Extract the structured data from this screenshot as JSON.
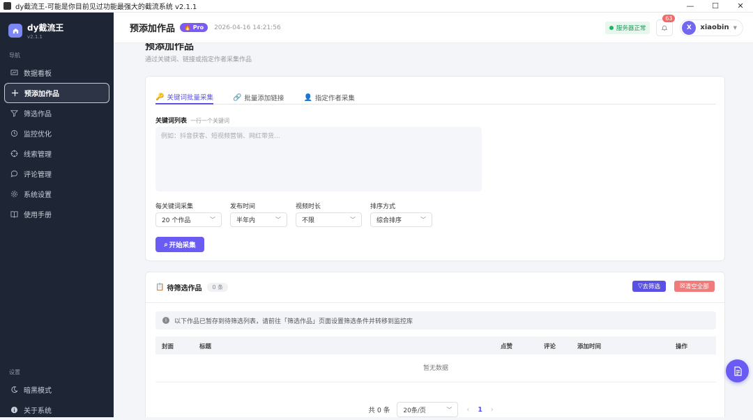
{
  "window": {
    "title": "dy截流王-可能是你目前见过功能最强大的截流系统 v2.1.1",
    "buttons": [
      "—",
      "☐",
      "✕"
    ]
  },
  "brand": {
    "name": "dy截流王",
    "version": "v2.1.1"
  },
  "sidebar": {
    "nav_label": "导航",
    "items": [
      {
        "label": "数据看板",
        "icon": "dashboard-icon"
      },
      {
        "label": "预添加作品",
        "icon": "plus-icon",
        "active": true
      },
      {
        "label": "筛选作品",
        "icon": "filter-icon"
      },
      {
        "label": "监控优化",
        "icon": "monitor-icon"
      },
      {
        "label": "线索管理",
        "icon": "target-icon"
      },
      {
        "label": "评论管理",
        "icon": "comment-icon"
      },
      {
        "label": "系统设置",
        "icon": "gear-icon"
      },
      {
        "label": "使用手册",
        "icon": "book-icon"
      }
    ],
    "settings_label": "设置",
    "bottom_items": [
      {
        "label": "暗黑模式",
        "icon": "moon-icon"
      },
      {
        "label": "关于系统",
        "icon": "info-icon"
      }
    ]
  },
  "topbar": {
    "title": "预添加作品",
    "pro_badge": "Pro",
    "timestamp": "2026-04-16 14:21:56",
    "server_status": "服务器正常",
    "notification_count": "63",
    "user_initial": "X",
    "username": "xiaobin"
  },
  "page": {
    "title": "预添加作品",
    "subtitle": "通过关键词、链接或指定作者采集作品"
  },
  "collect": {
    "tabs": [
      {
        "label": "关键词批量采集",
        "icon": "key-icon",
        "active": true
      },
      {
        "label": "批量添加链接",
        "icon": "link-icon"
      },
      {
        "label": "指定作者采集",
        "icon": "user-icon"
      }
    ],
    "keyword_label": "关键词列表",
    "keyword_hint": "一行一个关键词",
    "keyword_placeholder": "例如：抖音获客、短视频营销、网红带货...",
    "fields": [
      {
        "label": "每关键词采集",
        "value": "20 个作品"
      },
      {
        "label": "发布时间",
        "value": "半年内"
      },
      {
        "label": "视频时长",
        "value": "不限"
      },
      {
        "label": "排序方式",
        "value": "综合排序"
      }
    ],
    "start_button": "开始采集"
  },
  "pending": {
    "title": "待筛选作品",
    "count": "0 条",
    "filter_button": "去筛选",
    "clear_button": "清空全部",
    "notice": "以下作品已暂存到待筛选列表，请前往「筛选作品」页面设置筛选条件并转移到监控库",
    "columns": [
      "封面",
      "标题",
      "点赞",
      "评论",
      "添加时间",
      "操作"
    ],
    "empty_text": "暂无数据",
    "pagination": {
      "total": "共 0 条",
      "page_size": "20条/页",
      "current_page": "1"
    }
  },
  "colors": {
    "accent": "#6a5cf2",
    "sidebar_bg": "#1e2534",
    "danger": "#f07b7b",
    "success": "#22b36b"
  }
}
